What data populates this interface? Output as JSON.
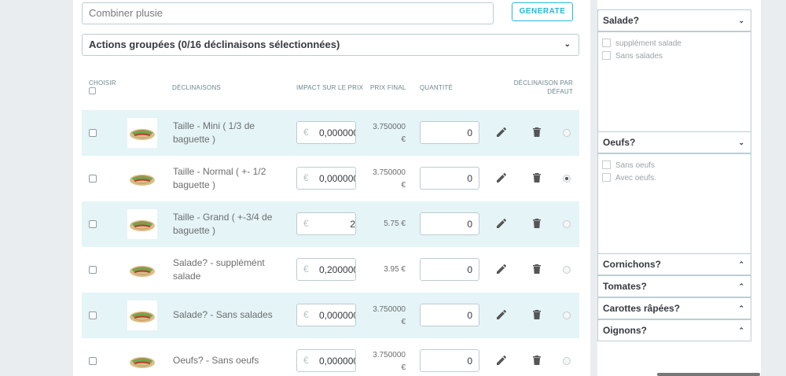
{
  "form": {
    "combine_placeholder": "Combiner plusie",
    "generate_label": "GENERATE",
    "bulk_actions_label": "Actions groupées (0/16 déclinaisons sélectionnées)"
  },
  "table": {
    "headers": {
      "choose": "CHOISIR",
      "declinations": "DÉCLINAISONS",
      "impact": "IMPACT SUR LE PRIX",
      "final_price": "PRIX FINAL",
      "quantity": "QUANTITÉ",
      "default": "DÉCLINAISON PAR DÉFAUT"
    },
    "currency": "€",
    "rows": [
      {
        "name": "Taille - Mini ( 1/3 de baguette )",
        "impact": "0,000000",
        "final_price": "3.750000 €",
        "quantity": "0",
        "default": false
      },
      {
        "name": "Taille - Normal ( +- 1/2 baguette )",
        "impact": "0,000000",
        "final_price": "3.750000 €",
        "quantity": "0",
        "default": true
      },
      {
        "name": "Taille - Grand ( +-3/4 de baguette )",
        "impact": "2",
        "final_price": "5.75 €",
        "quantity": "0",
        "default": false
      },
      {
        "name": "Salade? - supplémént salade",
        "impact": "0,200000",
        "final_price": "3.95 €",
        "quantity": "0",
        "default": false
      },
      {
        "name": "Salade? - Sans salades",
        "impact": "0,000000",
        "final_price": "3.750000 €",
        "quantity": "0",
        "default": false
      },
      {
        "name": "Oeufs? - Sans oeufs",
        "impact": "0,000000",
        "final_price": "3.750000 €",
        "quantity": "0",
        "default": false
      }
    ]
  },
  "attributes": {
    "salade": {
      "label": "Salade?",
      "options": [
        "supplément salade",
        "Sans salades"
      ]
    },
    "oeufs": {
      "label": "Oeufs?",
      "options": [
        "Sans oeufs",
        "Avec oeufs."
      ]
    },
    "cornichons": {
      "label": "Cornichons?"
    },
    "tomates": {
      "label": "Tomates?"
    },
    "carottes": {
      "label": "Carottes râpées?"
    },
    "oignons": {
      "label": "Oignons?"
    }
  }
}
